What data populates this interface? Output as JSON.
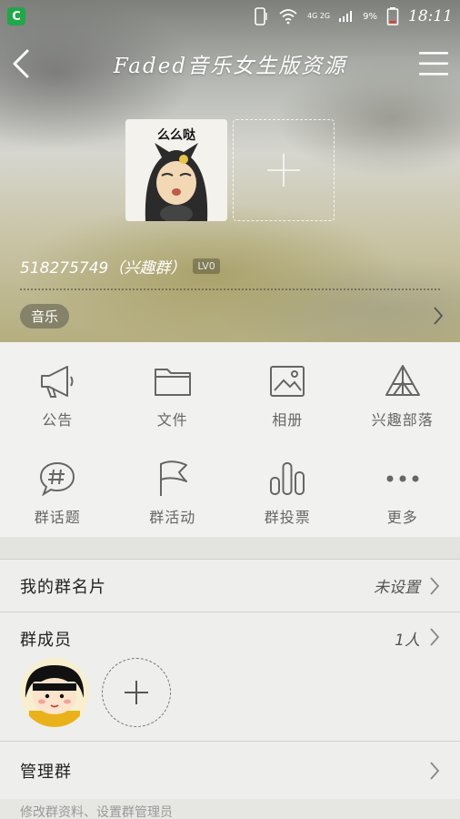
{
  "status_bar": {
    "app_icon": "C",
    "network": "4G 2G",
    "battery_percent": "9%",
    "time": "18:11"
  },
  "header": {
    "title": "Faded音乐女生版资源"
  },
  "group": {
    "id_text": "518275749（兴趣群）",
    "level_badge": "LV0",
    "tag": "音乐",
    "avatar_caption": "么么哒"
  },
  "grid": {
    "items": [
      {
        "label": "公告",
        "icon": "megaphone-icon"
      },
      {
        "label": "文件",
        "icon": "folder-icon"
      },
      {
        "label": "相册",
        "icon": "photo-icon"
      },
      {
        "label": "兴趣部落",
        "icon": "tent-icon"
      },
      {
        "label": "群话题",
        "icon": "hashtag-chat-icon"
      },
      {
        "label": "群活动",
        "icon": "flag-icon"
      },
      {
        "label": "群投票",
        "icon": "bar-chart-icon"
      },
      {
        "label": "更多",
        "icon": "more-dots-icon"
      }
    ]
  },
  "rows": {
    "card_label": "我的群名片",
    "card_value": "未设置",
    "members_label": "群成员",
    "members_value": "1人",
    "manage_label": "管理群",
    "bottom_text": "修改群资料、设置群管理员"
  },
  "colors": {
    "status_app": "#21a64a",
    "panel_bg": "#f1f1ef",
    "icon_gray": "#666666"
  }
}
